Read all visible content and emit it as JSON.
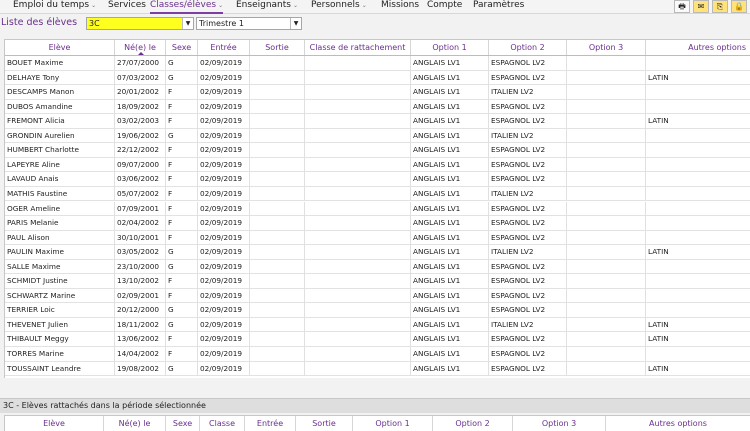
{
  "nav": {
    "items": [
      {
        "label": "Emploi du temps",
        "chevron": true,
        "active": false
      },
      {
        "label": "Services",
        "chevron": false,
        "active": false
      },
      {
        "label": "Classes/élèves",
        "chevron": true,
        "active": true
      },
      {
        "label": "Enseignants",
        "chevron": true,
        "active": false
      },
      {
        "label": "Personnels",
        "chevron": true,
        "active": false
      },
      {
        "label": "Missions",
        "chevron": false,
        "active": false
      },
      {
        "label": "Compte",
        "chevron": false,
        "active": false
      },
      {
        "label": "Paramètres",
        "chevron": false,
        "active": false
      }
    ]
  },
  "filters": {
    "list_title": "Liste des élèves",
    "class_value": "3C",
    "period_value": "Trimestre 1"
  },
  "table": {
    "columns": [
      "Elève",
      "Né(e) le",
      "Sexe",
      "Entrée",
      "Sortie",
      "Classe de rattachement",
      "Option 1",
      "Option 2",
      "Option 3",
      "Autres options"
    ],
    "rows": [
      [
        "BOUET Maxime",
        "27/07/2000",
        "G",
        "02/09/2019",
        "",
        "",
        "ANGLAIS LV1",
        "ESPAGNOL LV2",
        "",
        ""
      ],
      [
        "DELHAYE Tony",
        "07/03/2002",
        "G",
        "02/09/2019",
        "",
        "",
        "ANGLAIS LV1",
        "ESPAGNOL LV2",
        "",
        "LATIN"
      ],
      [
        "DESCAMPS Manon",
        "20/01/2002",
        "F",
        "02/09/2019",
        "",
        "",
        "ANGLAIS LV1",
        "ITALIEN LV2",
        "",
        ""
      ],
      [
        "DUBOS Amandine",
        "18/09/2002",
        "F",
        "02/09/2019",
        "",
        "",
        "ANGLAIS LV1",
        "ESPAGNOL LV2",
        "",
        ""
      ],
      [
        "FREMONT Alicia",
        "03/02/2003",
        "F",
        "02/09/2019",
        "",
        "",
        "ANGLAIS LV1",
        "ESPAGNOL LV2",
        "",
        "LATIN"
      ],
      [
        "GRONDIN Aurelien",
        "19/06/2002",
        "G",
        "02/09/2019",
        "",
        "",
        "ANGLAIS LV1",
        "ITALIEN LV2",
        "",
        ""
      ],
      [
        "HUMBERT Charlotte",
        "22/12/2002",
        "F",
        "02/09/2019",
        "",
        "",
        "ANGLAIS LV1",
        "ESPAGNOL LV2",
        "",
        ""
      ],
      [
        "LAPEYRE Aline",
        "09/07/2000",
        "F",
        "02/09/2019",
        "",
        "",
        "ANGLAIS LV1",
        "ESPAGNOL LV2",
        "",
        ""
      ],
      [
        "LAVAUD Anais",
        "03/06/2002",
        "F",
        "02/09/2019",
        "",
        "",
        "ANGLAIS LV1",
        "ESPAGNOL LV2",
        "",
        ""
      ],
      [
        "MATHIS Faustine",
        "05/07/2002",
        "F",
        "02/09/2019",
        "",
        "",
        "ANGLAIS LV1",
        "ITALIEN LV2",
        "",
        ""
      ],
      [
        "OGER Ameline",
        "07/09/2001",
        "F",
        "02/09/2019",
        "",
        "",
        "ANGLAIS LV1",
        "ESPAGNOL LV2",
        "",
        ""
      ],
      [
        "PARIS Melanie",
        "02/04/2002",
        "F",
        "02/09/2019",
        "",
        "",
        "ANGLAIS LV1",
        "ESPAGNOL LV2",
        "",
        ""
      ],
      [
        "PAUL Alison",
        "30/10/2001",
        "F",
        "02/09/2019",
        "",
        "",
        "ANGLAIS LV1",
        "ESPAGNOL LV2",
        "",
        ""
      ],
      [
        "PAULIN Maxime",
        "03/05/2002",
        "G",
        "02/09/2019",
        "",
        "",
        "ANGLAIS LV1",
        "ITALIEN LV2",
        "",
        "LATIN"
      ],
      [
        "SALLE Maxime",
        "23/10/2000",
        "G",
        "02/09/2019",
        "",
        "",
        "ANGLAIS LV1",
        "ESPAGNOL LV2",
        "",
        ""
      ],
      [
        "SCHMIDT Justine",
        "13/10/2002",
        "F",
        "02/09/2019",
        "",
        "",
        "ANGLAIS LV1",
        "ESPAGNOL LV2",
        "",
        ""
      ],
      [
        "SCHWARTZ Marine",
        "02/09/2001",
        "F",
        "02/09/2019",
        "",
        "",
        "ANGLAIS LV1",
        "ESPAGNOL LV2",
        "",
        ""
      ],
      [
        "TERRIER Loic",
        "20/12/2000",
        "G",
        "02/09/2019",
        "",
        "",
        "ANGLAIS LV1",
        "ESPAGNOL LV2",
        "",
        ""
      ],
      [
        "THEVENET Julien",
        "18/11/2002",
        "G",
        "02/09/2019",
        "",
        "",
        "ANGLAIS LV1",
        "ITALIEN LV2",
        "",
        "LATIN"
      ],
      [
        "THIBAULT Meggy",
        "13/06/2002",
        "F",
        "02/09/2019",
        "",
        "",
        "ANGLAIS LV1",
        "ESPAGNOL LV2",
        "",
        "LATIN"
      ],
      [
        "TORRES Marine",
        "14/04/2002",
        "F",
        "02/09/2019",
        "",
        "",
        "ANGLAIS LV1",
        "ESPAGNOL LV2",
        "",
        ""
      ],
      [
        "TOUSSAINT Leandre",
        "19/08/2002",
        "G",
        "02/09/2019",
        "",
        "",
        "ANGLAIS LV1",
        "ESPAGNOL LV2",
        "",
        "LATIN"
      ]
    ]
  },
  "attached": {
    "section_title": "3C - Elèves rattachés dans la période sélectionnée",
    "columns": [
      "Elève",
      "Né(e) le",
      "Sexe",
      "Classe",
      "Entrée",
      "Sortie",
      "Option 1",
      "Option 2",
      "Option 3",
      "Autres options"
    ]
  },
  "colors": {
    "accent": "#6a2f8e",
    "class_select_bg": "#ffff1f"
  },
  "icons": [
    "print-icon",
    "alert-icon",
    "export-icon",
    "lock-icon"
  ]
}
